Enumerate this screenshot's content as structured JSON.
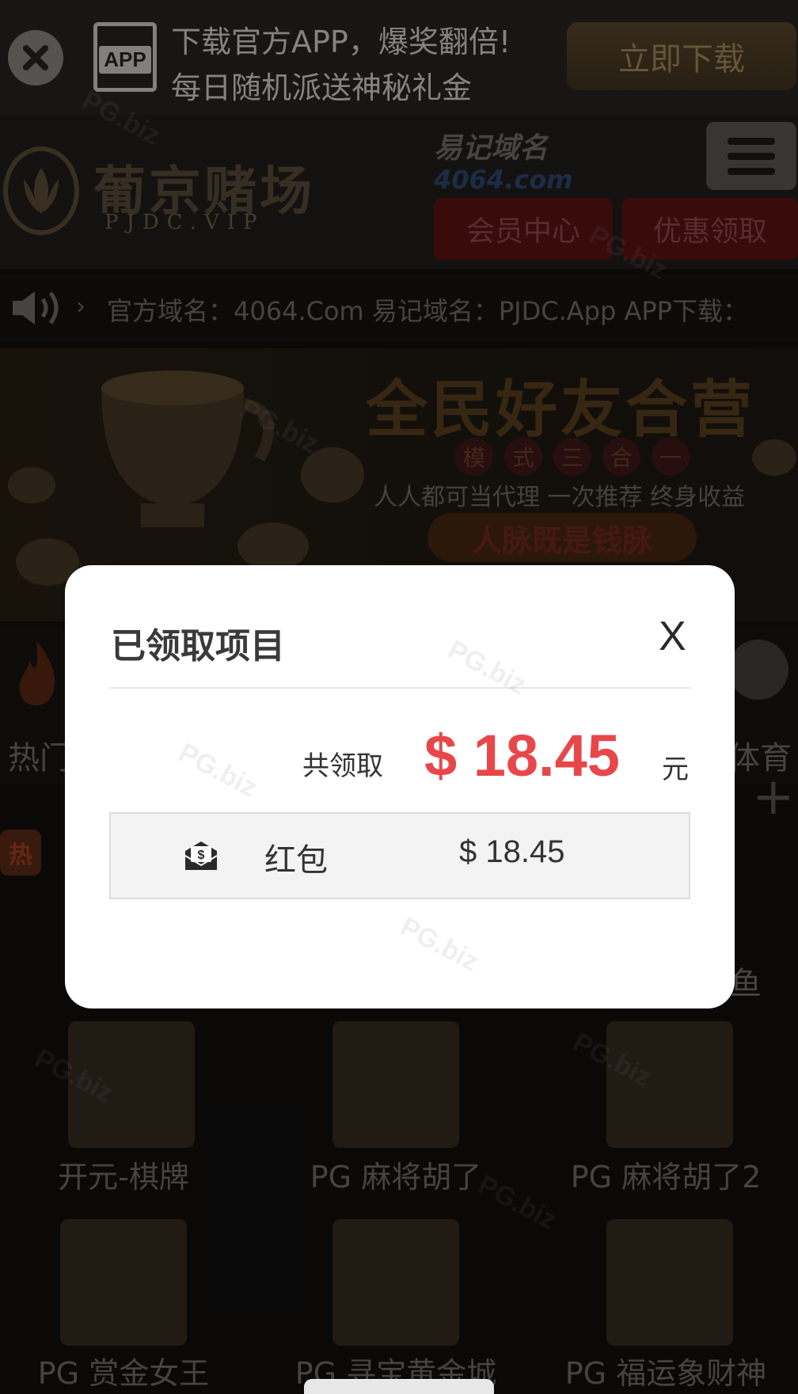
{
  "download_bar": {
    "app_badge": "APP",
    "line1": "下载官方APP，爆奖翻倍!",
    "line2": "每日随机派送神秘礼金",
    "button": "立即下载"
  },
  "header": {
    "brand_name": "葡京赌场",
    "brand_domain": "PJDC.VIP",
    "easy_label": "易记域名",
    "easy_domain": "4064.com",
    "member_center": "会员中心",
    "promotions": "优惠领取"
  },
  "marquee": {
    "arrow": "›",
    "text": "官方域名：4064.Com  易记域名：PJDC.App  APP下载："
  },
  "banner": {
    "title": "全民好友合营",
    "mode_chars": [
      "模",
      "式",
      "三",
      "合",
      "一"
    ],
    "subtitle": "人人都可当代理 一次推荐 终身收益",
    "pill": "人脉既是钱脉"
  },
  "categories": {
    "hot": "热门",
    "sport": "体育",
    "hot_badge": "热",
    "fish": "鱼",
    "plus": "+"
  },
  "games": [
    {
      "label": "开元-棋牌"
    },
    {
      "label": "PG 麻将胡了"
    },
    {
      "label": "PG 麻将胡了2"
    },
    {
      "label": "PG 赏金女王"
    },
    {
      "label": "PG 寻宝黄金城"
    },
    {
      "label": "PG 福运象财神"
    }
  ],
  "modal": {
    "title": "已领取项目",
    "close": "X",
    "total_label": "共领取",
    "total_amount": "$ 18.45",
    "total_unit": "元",
    "items": [
      {
        "name": "红包",
        "amount": "$ 18.45"
      }
    ]
  },
  "watermark": "PG.biz",
  "colors": {
    "accent_red": "#e8474a",
    "modal_bg": "#ffffff",
    "page_bg": "#0b0a09"
  }
}
